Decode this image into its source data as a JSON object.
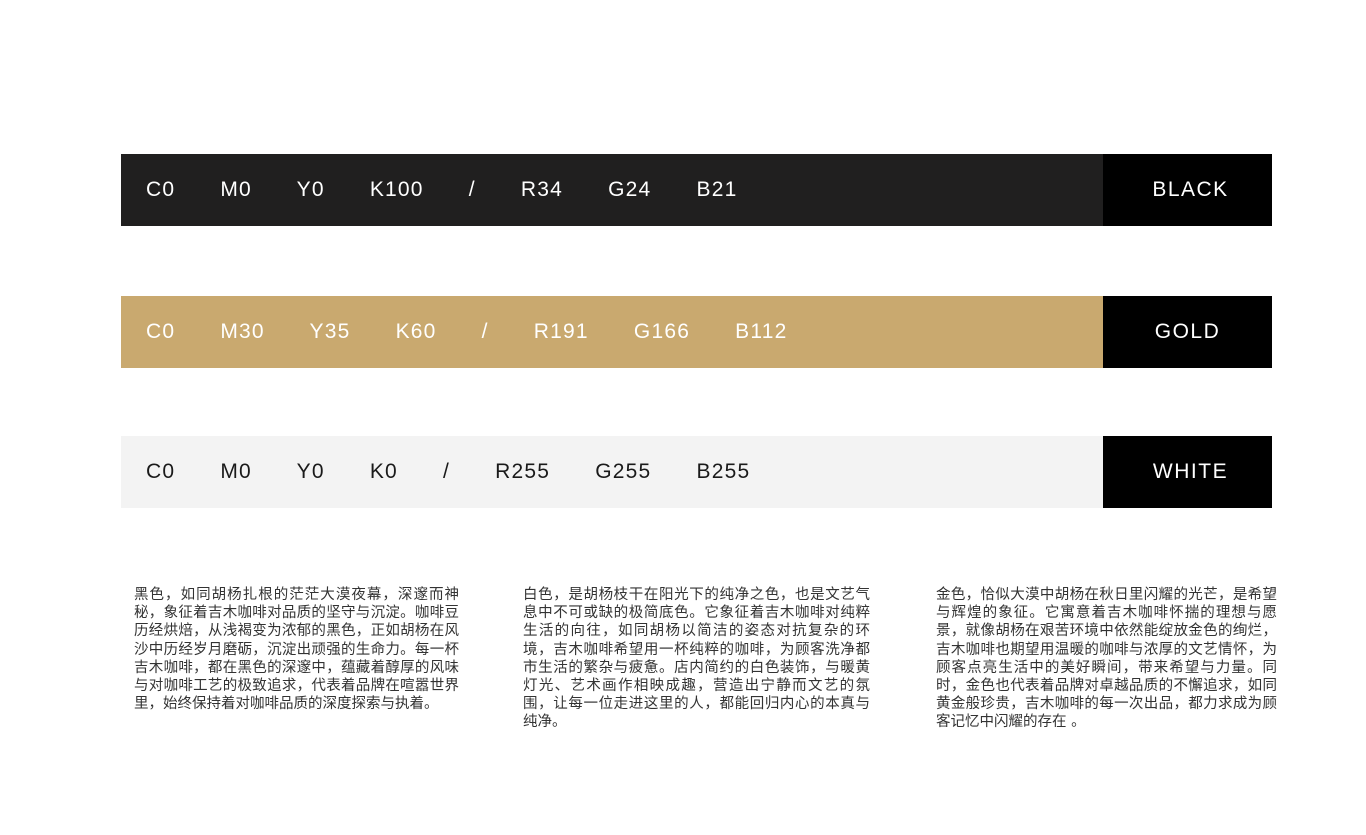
{
  "swatches": [
    {
      "values": "C0   M0   Y0   K100   /   R34   G24   B21",
      "name": "BLACK",
      "bar_color": "#201f1f",
      "text_color": "#ffffff"
    },
    {
      "values": "C0   M30   Y35   K60   /   R191   G166   B112",
      "name": "GOLD",
      "bar_color": "#c9a96f",
      "text_color": "#ffffff"
    },
    {
      "values": "C0   M0   Y0   K0   /   R255   G255   B255",
      "name": "WHITE",
      "bar_color": "#f3f3f3",
      "text_color": "#1a1a1a"
    }
  ],
  "descriptions": [
    "黑色，如同胡杨扎根的茫茫大漠夜幕，深邃而神秘，象征着吉木咖啡对品质的坚守与沉淀。咖啡豆历经烘焙，从浅褐变为浓郁的黑色，正如胡杨在风沙中历经岁月磨砺，沉淀出顽强的生命力。每一杯吉木咖啡，都在黑色的深邃中，蕴藏着醇厚的风味与对咖啡工艺的极致追求，代表着品牌在喧嚣世界里，始终保持着对咖啡品质的深度探索与执着。",
    "白色，是胡杨枝干在阳光下的纯净之色，也是文艺气息中不可或缺的极简底色。它象征着吉木咖啡对纯粹生活的向往，如同胡杨以简洁的姿态对抗复杂的环境，吉木咖啡希望用一杯纯粹的咖啡，为顾客洗净都市生活的繁杂与疲惫。店内简约的白色装饰，与暖黄灯光、艺术画作相映成趣，营造出宁静而文艺的氛围，让每一位走进这里的人，都能回归内心的本真与纯净。",
    "金色，恰似大漠中胡杨在秋日里闪耀的光芒，是希望与辉煌的象征。它寓意着吉木咖啡怀揣的理想与愿景，就像胡杨在艰苦环境中依然能绽放金色的绚烂，吉木咖啡也期望用温暖的咖啡与浓厚的文艺情怀，为顾客点亮生活中的美好瞬间，带来希望与力量。同时，金色也代表着品牌对卓越品质的不懈追求，如同黄金般珍贵，吉木咖啡的每一次出品，都力求成为顾客记忆中闪耀的存在 。"
  ]
}
